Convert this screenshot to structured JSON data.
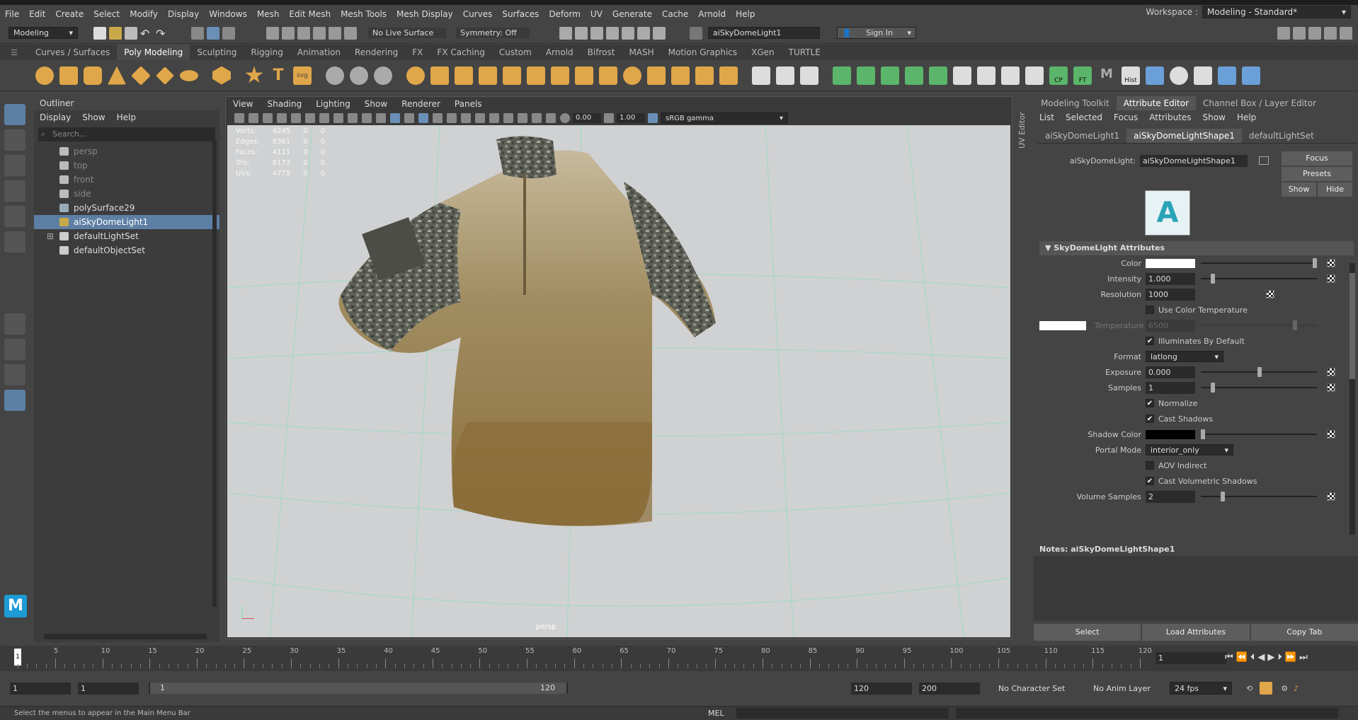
{
  "menu": [
    "File",
    "Edit",
    "Create",
    "Select",
    "Modify",
    "Display",
    "Windows",
    "Mesh",
    "Edit Mesh",
    "Mesh Tools",
    "Mesh Display",
    "Curves",
    "Surfaces",
    "Deform",
    "UV",
    "Generate",
    "Cache",
    "Arnold",
    "Help"
  ],
  "workspace": {
    "label": "Workspace :",
    "value": "Modeling - Standard*"
  },
  "status": {
    "mode": "Modeling",
    "live_surface": "No Live Surface",
    "symmetry": "Symmetry: Off",
    "selected": "aiSkyDomeLight1",
    "sign_in": "Sign In"
  },
  "shelf_tabs": [
    "Curves / Surfaces",
    "Poly Modeling",
    "Sculpting",
    "Rigging",
    "Animation",
    "Rendering",
    "FX",
    "FX Caching",
    "Custom",
    "Arnold",
    "Bifrost",
    "MASH",
    "Motion Graphics",
    "XGen",
    "TURTLE"
  ],
  "shelf_labels": {
    "cp": "CP",
    "ft": "FT",
    "hist": "Hist"
  },
  "outliner": {
    "title": "Outliner",
    "menu": [
      "Display",
      "Show",
      "Help"
    ],
    "search": "Search...",
    "items": [
      {
        "label": "persp",
        "grey": true
      },
      {
        "label": "top",
        "grey": true
      },
      {
        "label": "front",
        "grey": true
      },
      {
        "label": "side",
        "grey": true
      },
      {
        "label": "polySurface29"
      },
      {
        "label": "aiSkyDomeLight1",
        "selected": true
      },
      {
        "label": "defaultLightSet",
        "expand": "⊞"
      },
      {
        "label": "defaultObjectSet"
      }
    ]
  },
  "viewport": {
    "menu": [
      "View",
      "Shading",
      "Lighting",
      "Show",
      "Renderer",
      "Panels"
    ],
    "exposure": "0.00",
    "gamma": "1.00",
    "colorspace": "sRGB gamma",
    "camera": "persp",
    "stats": [
      [
        "Verts:",
        "4245",
        "0",
        "0"
      ],
      [
        "Edges:",
        "8361",
        "0",
        "0"
      ],
      [
        "Faces:",
        "4111",
        "0",
        "0"
      ],
      [
        "Tris:",
        "8173",
        "0",
        "0"
      ],
      [
        "UVs:",
        "4775",
        "0",
        "0"
      ]
    ]
  },
  "side_tab": "UV Editor",
  "ae": {
    "tabs": [
      "Modeling Toolkit",
      "Attribute Editor",
      "Channel Box / Layer Editor"
    ],
    "menu": [
      "List",
      "Selected",
      "Focus",
      "Attributes",
      "Show",
      "Help"
    ],
    "node_tabs": [
      "aiSkyDomeLight1",
      "aiSkyDomeLightShape1",
      "defaultLightSet"
    ],
    "node_label": "aiSkyDomeLight:",
    "node_value": "aiSkyDomeLightShape1",
    "buttons": {
      "focus": "Focus",
      "presets": "Presets",
      "show": "Show",
      "hide": "Hide"
    },
    "section": "SkyDomeLight Attributes",
    "color": "Color",
    "intensity": "Intensity",
    "intensity_v": "1.000",
    "resolution": "Resolution",
    "resolution_v": "1000",
    "use_temp": "Use Color Temperature",
    "temperature": "Temperature",
    "temperature_v": "6500",
    "illum": "Illuminates By Default",
    "format": "Format",
    "format_v": "latlong",
    "exposure": "Exposure",
    "exposure_v": "0.000",
    "samples": "Samples",
    "samples_v": "1",
    "normalize": "Normalize",
    "cast_shadows": "Cast Shadows",
    "shadow_color": "Shadow Color",
    "portal": "Portal Mode",
    "portal_v": "interior_only",
    "aov": "AOV Indirect",
    "cast_vol": "Cast Volumetric Shadows",
    "vol_samples": "Volume Samples",
    "vol_samples_v": "2",
    "notes": "Notes:  aiSkyDomeLightShape1",
    "select": "Select",
    "load": "Load Attributes",
    "copy": "Copy Tab"
  },
  "timeline": {
    "ticks": [
      "5",
      "10",
      "15",
      "20",
      "25",
      "30",
      "35",
      "40",
      "45",
      "50",
      "55",
      "60",
      "65",
      "70",
      "75",
      "80",
      "85",
      "90",
      "95",
      "100",
      "105",
      "110",
      "115",
      "120"
    ],
    "current": "1",
    "start_marker": "1"
  },
  "range": {
    "start": "1",
    "start2": "1",
    "slider_start": "1",
    "slider_end": "120",
    "end": "120",
    "end2": "200",
    "char_set": "No Character Set",
    "anim_layer": "No Anim Layer",
    "fps": "24 fps"
  },
  "help": {
    "text": "Select the menus to appear in the Main Menu Bar",
    "mel": "MEL"
  }
}
